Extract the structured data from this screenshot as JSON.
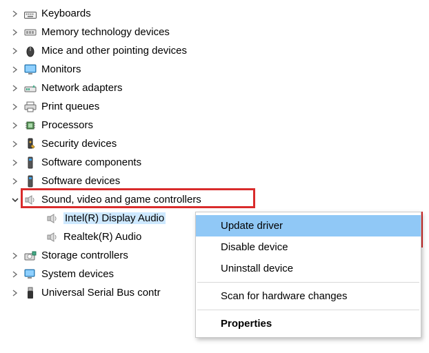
{
  "tree": {
    "items": [
      {
        "label": "Keyboards",
        "icon": "keyboard"
      },
      {
        "label": "Memory technology devices",
        "icon": "memory"
      },
      {
        "label": "Mice and other pointing devices",
        "icon": "mouse"
      },
      {
        "label": "Monitors",
        "icon": "monitor"
      },
      {
        "label": "Network adapters",
        "icon": "network"
      },
      {
        "label": "Print queues",
        "icon": "printer"
      },
      {
        "label": "Processors",
        "icon": "cpu"
      },
      {
        "label": "Security devices",
        "icon": "security"
      },
      {
        "label": "Software components",
        "icon": "software"
      },
      {
        "label": "Software devices",
        "icon": "software"
      },
      {
        "label": "Sound, video and game controllers",
        "icon": "speaker",
        "expanded": true,
        "highlighted": true,
        "children": [
          {
            "label": "Intel(R) Display Audio",
            "icon": "speaker",
            "selected": true
          },
          {
            "label": "Realtek(R) Audio",
            "icon": "speaker"
          }
        ]
      },
      {
        "label": "Storage controllers",
        "icon": "storage"
      },
      {
        "label": "System devices",
        "icon": "system"
      },
      {
        "label": "Universal Serial Bus contr",
        "icon": "usb"
      }
    ]
  },
  "context_menu": {
    "items": [
      {
        "label": "Update driver",
        "selected": true
      },
      {
        "label": "Disable device"
      },
      {
        "label": "Uninstall device"
      },
      {
        "sep": true
      },
      {
        "label": "Scan for hardware changes"
      },
      {
        "sep": true
      },
      {
        "label": "Properties",
        "bold": true
      }
    ]
  },
  "colors": {
    "highlight_border": "#d92b2b",
    "menu_selected": "#90c8f6",
    "tree_selected": "#cde8ff"
  }
}
